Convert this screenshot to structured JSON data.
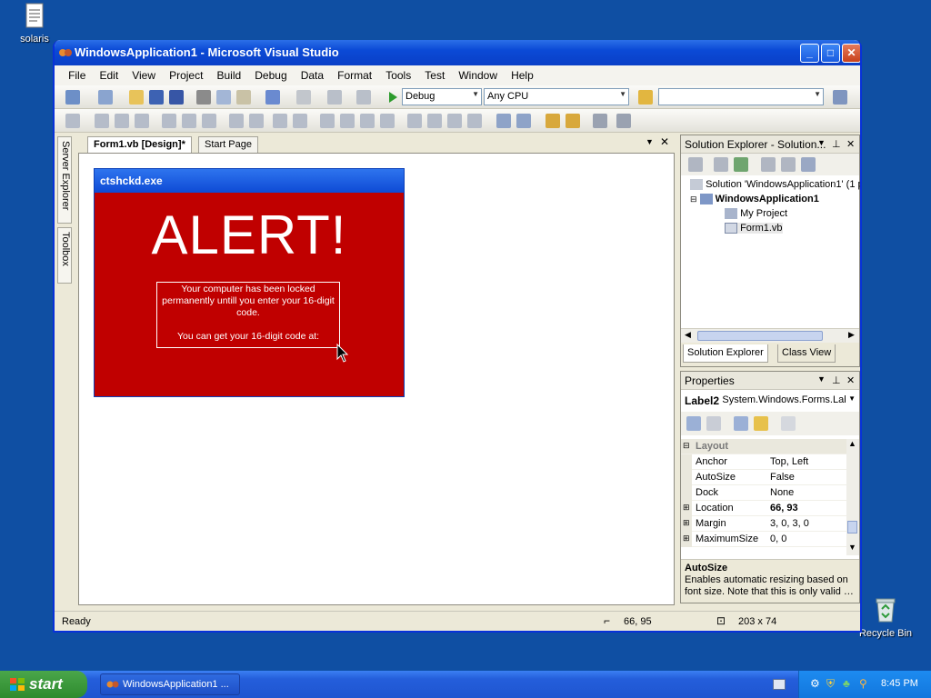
{
  "desktop": {
    "icons": [
      {
        "name": "solaris",
        "icon": "document-icon"
      },
      {
        "name": "Recycle Bin",
        "icon": "recycle-bin-icon"
      }
    ]
  },
  "window": {
    "title": "WindowsApplication1 - Microsoft Visual Studio",
    "menu": [
      "File",
      "Edit",
      "View",
      "Project",
      "Build",
      "Debug",
      "Data",
      "Format",
      "Tools",
      "Test",
      "Window",
      "Help"
    ],
    "toolbar": {
      "config_value": "Debug",
      "platform_value": "Any CPU",
      "find_value": ""
    }
  },
  "side_tabs": [
    "Server Explorer",
    "Toolbox"
  ],
  "document": {
    "tabs": [
      {
        "label": "Form1.vb [Design]*",
        "active": true
      },
      {
        "label": "Start Page",
        "active": false
      }
    ]
  },
  "form": {
    "title": "ctshckd.exe",
    "heading": "ALERT!",
    "message_line1": "Your computer has been locked permanently untill you enter your 16-digit code.",
    "message_line2": "You can get your 16-digit code at:",
    "background_color": "#c00000"
  },
  "solution_explorer": {
    "title": "Solution Explorer - Solution...",
    "tree": [
      {
        "label": "Solution 'WindowsApplication1' (1 p",
        "level": 0,
        "bold": false
      },
      {
        "label": "WindowsApplication1",
        "level": 1,
        "bold": true
      },
      {
        "label": "My Project",
        "level": 2,
        "bold": false
      },
      {
        "label": "Form1.vb",
        "level": 2,
        "bold": false
      }
    ],
    "tabs": [
      "Solution Explorer",
      "Class View"
    ]
  },
  "properties": {
    "title": "Properties",
    "selected_object": "Label2",
    "selected_type": "System.Windows.Forms.Label",
    "category": "Layout",
    "rows": [
      {
        "name": "Anchor",
        "value": "Top, Left",
        "bold": false,
        "expandable": false
      },
      {
        "name": "AutoSize",
        "value": "False",
        "bold": false,
        "expandable": false
      },
      {
        "name": "Dock",
        "value": "None",
        "bold": false,
        "expandable": false
      },
      {
        "name": "Location",
        "value": "66, 93",
        "bold": true,
        "expandable": true
      },
      {
        "name": "Margin",
        "value": "3, 0, 3, 0",
        "bold": false,
        "expandable": true
      },
      {
        "name": "MaximumSize",
        "value": "0, 0",
        "bold": false,
        "expandable": true
      }
    ],
    "description_title": "AutoSize",
    "description_text": "Enables automatic resizing based on font size. Note that this is only valid …"
  },
  "status": {
    "text": "Ready",
    "position": "66, 95",
    "size": "203 x 74"
  },
  "taskbar": {
    "start_label": "start",
    "task_label": "WindowsApplication1 ...",
    "clock": "8:45 PM"
  },
  "colors": {
    "desktop": "#0f4fa3",
    "titlebar": "#0b4ad6",
    "alert_red": "#c00000"
  }
}
